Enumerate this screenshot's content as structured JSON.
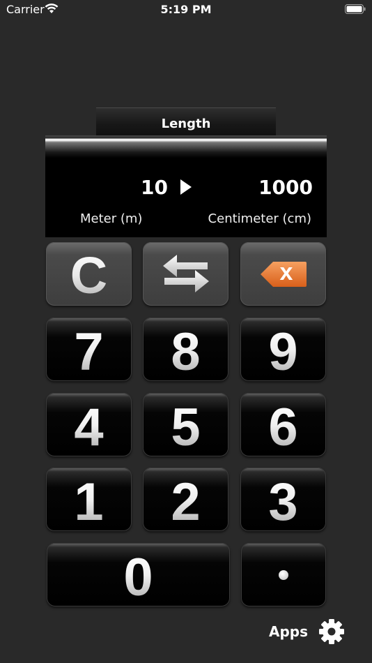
{
  "status_bar": {
    "carrier": "Carrier",
    "time": "5:19 PM",
    "icons": [
      "wifi-icon",
      "battery-icon"
    ]
  },
  "converter": {
    "category": "Length",
    "from_value": "10",
    "to_value": "1000",
    "from_unit": "Meter (m)",
    "to_unit": "Centimeter (cm)",
    "arrow_icon": "play-arrow-icon"
  },
  "keypad": {
    "clear_label": "C",
    "swap_icon": "swap-arrows-icon",
    "backspace_icon": "backspace-icon",
    "backspace_label": "x",
    "backspace_color": "#e8762d",
    "digits": {
      "d7": "7",
      "d8": "8",
      "d9": "9",
      "d4": "4",
      "d5": "5",
      "d6": "6",
      "d1": "1",
      "d2": "2",
      "d3": "3",
      "d0": "0"
    },
    "decimal_icon": "decimal-point"
  },
  "footer": {
    "apps_label": "Apps",
    "settings_icon": "gear-icon"
  }
}
